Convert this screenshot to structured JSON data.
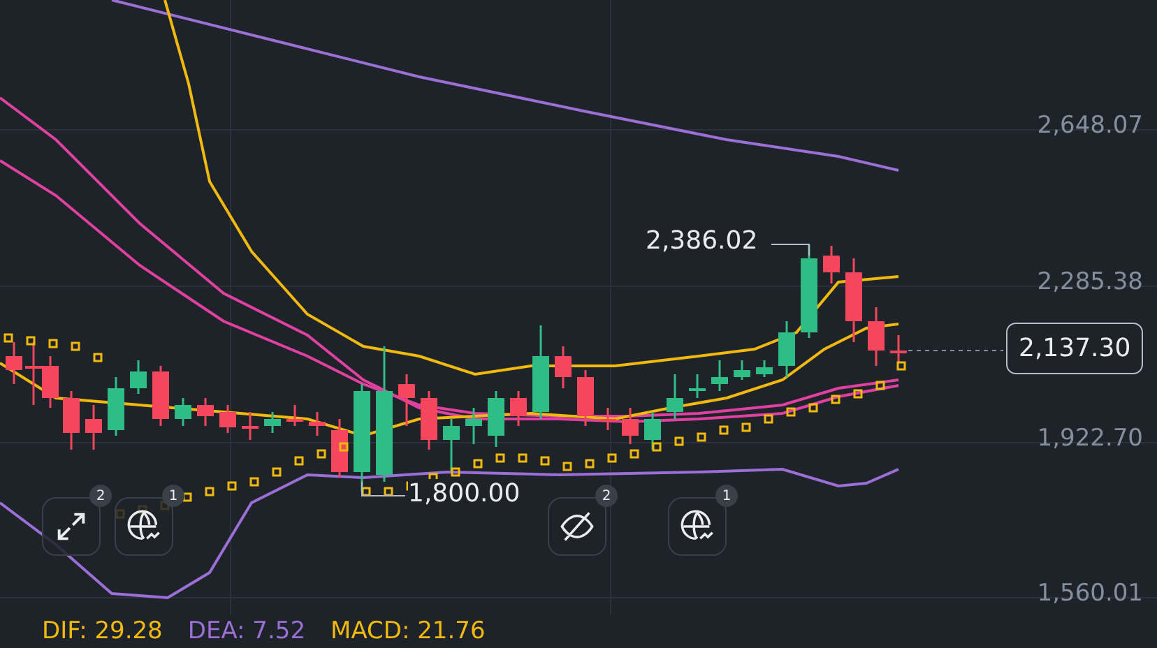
{
  "price_axis": [
    {
      "label": "2,648.07"
    },
    {
      "label": "2,285.38"
    },
    {
      "label": "1,922.70"
    },
    {
      "label": "1,560.01"
    }
  ],
  "high_marker": "2,386.02",
  "low_marker": "1,800.00",
  "last_price": "2,137.30",
  "floating_buttons": [
    {
      "kind": "expand",
      "badge": "2"
    },
    {
      "kind": "globe",
      "badge": "1"
    },
    {
      "kind": "hide",
      "badge": "2"
    },
    {
      "kind": "globe",
      "badge": "1"
    }
  ],
  "indicator_legend": [
    {
      "label": "DIF: 29.28",
      "color": "#f0b90b"
    },
    {
      "label": "DEA: 7.52",
      "color": "#9b6fd6"
    },
    {
      "label": "MACD: 21.76",
      "color": "#f0b90b"
    }
  ]
}
